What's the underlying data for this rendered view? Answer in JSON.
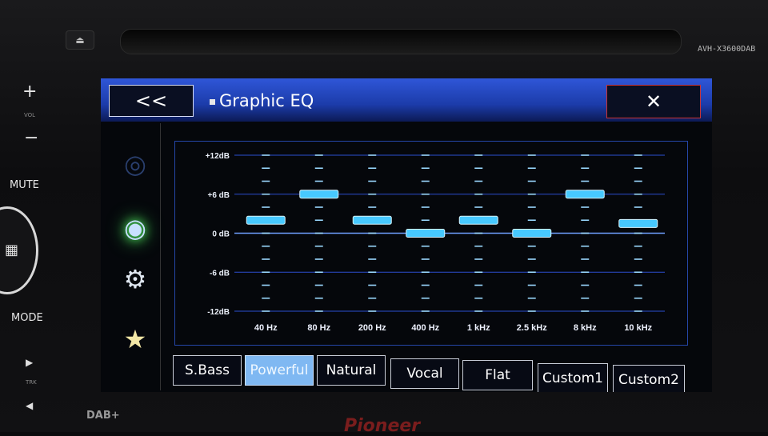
{
  "device": {
    "model": "AVH-X3600DAB",
    "vol_plus": "+",
    "vol_label": "VOL",
    "vol_minus": "−",
    "mute": "MUTE",
    "mode": "MODE",
    "trk_label": "TRK",
    "dab_logo": "DAB+",
    "brand": "Pioneer"
  },
  "header": {
    "back_label": "<<",
    "title": "Graphic EQ",
    "close_label": "✕"
  },
  "side_menu": [
    {
      "name": "audio-icon",
      "glyph": "◎"
    },
    {
      "name": "speaker-icon",
      "glyph": "◉"
    },
    {
      "name": "settings-icon",
      "glyph": "⚙"
    },
    {
      "name": "favorite-icon",
      "glyph": "★"
    }
  ],
  "chart_data": {
    "type": "bar",
    "title": "",
    "xlabel": "",
    "ylabel": "",
    "ylim": [
      -12,
      12
    ],
    "ytick_labels": [
      "+12dB",
      "+6 dB",
      "0 dB",
      "-6 dB",
      "-12dB"
    ],
    "yticks": [
      12,
      6,
      0,
      -6,
      -12
    ],
    "categories": [
      "40 Hz",
      "80 Hz",
      "200 Hz",
      "400 Hz",
      "1 kHz",
      "2.5 kHz",
      "8 kHz",
      "10 kHz"
    ],
    "values": [
      2,
      6,
      2,
      0,
      2,
      0,
      6,
      1.5
    ],
    "grid": true,
    "colors": {
      "slider": "#47c9ff",
      "tick": "#9ad8ff",
      "grid": "#2c4fd0",
      "zero": "#6fa0ff"
    }
  },
  "presets": {
    "items": [
      "S.Bass",
      "Powerful",
      "Natural",
      "Vocal",
      "Flat",
      "Custom1",
      "Custom2"
    ],
    "active_index": 1
  }
}
